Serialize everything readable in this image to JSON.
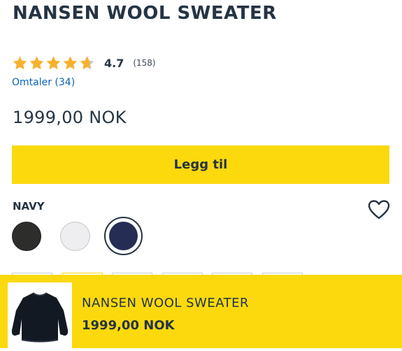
{
  "product": {
    "title": "NANSEN WOOL SWEATER",
    "rating_value": "4.7",
    "rating_fraction": 0.94,
    "rating_count": "(158)",
    "reviews_link": "Omtaler (34)",
    "price": "1999,00 NOK"
  },
  "actions": {
    "add_to_cart": "Legg til"
  },
  "color": {
    "selected_label": "NAVY",
    "swatches": [
      {
        "name": "black",
        "hex": "#2d2d2b"
      },
      {
        "name": "light-grey",
        "hex": "#eeeef0"
      },
      {
        "name": "navy",
        "hex": "#262d55",
        "selected": true
      }
    ]
  },
  "sticky_bar": {
    "name": "NANSEN WOOL SWEATER",
    "price": "1999,00 NOK"
  },
  "colors": {
    "accent_yellow": "#fbd90d",
    "star_orange": "#f7b12f",
    "text_dark": "#253444",
    "link_blue": "#0b63b6"
  },
  "icons": [
    "star-icon",
    "heart-icon"
  ]
}
